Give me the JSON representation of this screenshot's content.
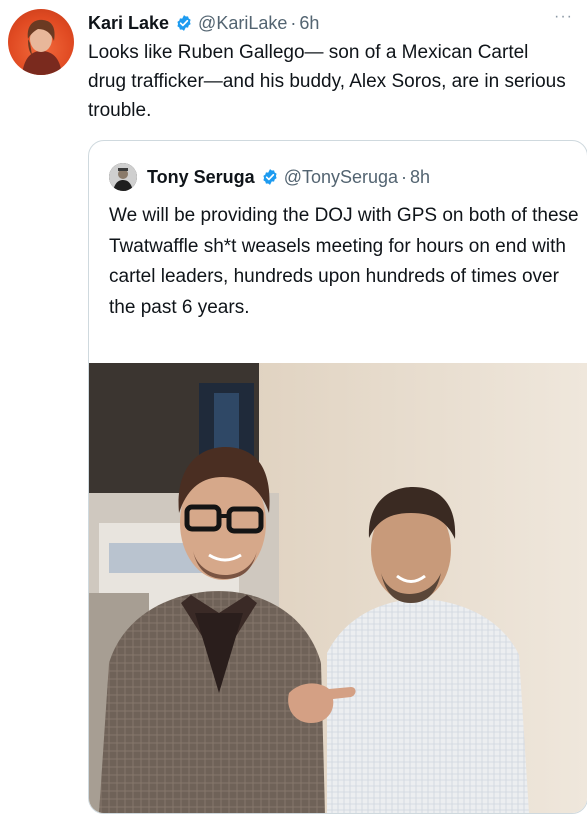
{
  "tweet": {
    "author_name": "Kari Lake",
    "handle": "@KariLake",
    "time_sep": "·",
    "time": "6h",
    "text": "Looks like Ruben Gallego— son of a Mexican Cartel drug trafficker—and his buddy, Alex Soros, are in serious trouble.",
    "more_icon": "···"
  },
  "quote": {
    "author_name": "Tony Seruga",
    "handle": "@TonySeruga",
    "time_sep": "·",
    "time": "8h",
    "text": "We will be providing the DOJ with GPS on both of these Twatwaffle sh*t weasels meeting for hours on end with cartel leaders, hundreds upon hundreds of times over the past 6 years."
  },
  "colors": {
    "verified": "#1d9bf0",
    "secondary_text": "#536471",
    "border": "#cfd9de"
  }
}
